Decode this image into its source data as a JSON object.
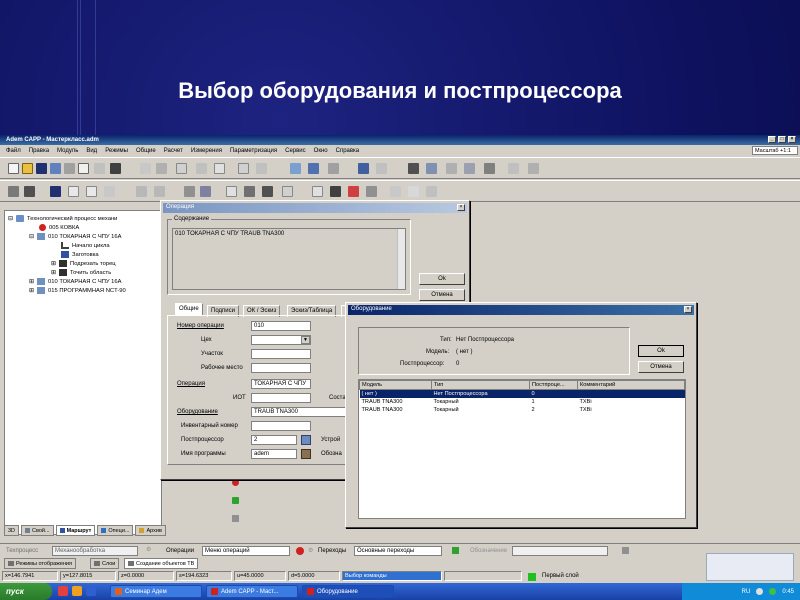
{
  "slide": {
    "title": "Выбор оборудования и постпроцессора"
  },
  "app": {
    "title": "Adem CAPP - Мастеркласс.adm",
    "window_controls": [
      "_",
      "□",
      "×"
    ],
    "menu": [
      "Файл",
      "Правка",
      "Модуль",
      "Вид",
      "Режимы",
      "Общие",
      "Расчет",
      "Измерения",
      "Параметризация",
      "Сервис",
      "Окно",
      "Справка"
    ],
    "zoom": "Масштаб +1:1"
  },
  "tree": {
    "items": [
      {
        "label": "Технологический процесс механи",
        "icon": "process-icon",
        "color": "#6a8fc8"
      },
      {
        "label": "005  КОВКА",
        "icon": "operation-red-icon",
        "color": "#d02020"
      },
      {
        "label": "010  ТОКАРНАЯ С ЧПУ 16А",
        "icon": "operation-icon",
        "color": "#7090c0"
      },
      {
        "label": "Начало цикла",
        "icon": "start-cycle-icon",
        "color": "#404040"
      },
      {
        "label": "Заготовка",
        "icon": "blank-icon",
        "color": "#3050a0"
      },
      {
        "label": "Подрезать торец",
        "icon": "face-icon",
        "color": "#303030"
      },
      {
        "label": "Точить область",
        "icon": "turn-icon",
        "color": "#303030"
      },
      {
        "label": "010  ТОКАРНАЯ С ЧПУ 16А",
        "icon": "operation-icon",
        "color": "#7090c0"
      },
      {
        "label": "015  ПРОГРАММНАЯ NCT-90",
        "icon": "operation-icon",
        "color": "#7090c0"
      }
    ],
    "tabs": [
      "3D",
      "Свой...",
      "Маршрут",
      "Опеци...",
      "Архив"
    ]
  },
  "operation_dialog": {
    "title": "Операция",
    "content_label": "Содержание",
    "content_text": "010  ТОКАРНАЯ С ЧПУ TRAUB TNA300",
    "ok": "Ok",
    "cancel": "Отмена",
    "tabs": [
      "Общие",
      "Подписи",
      "ОК / Эскиз",
      "Эскиз/Таблица",
      "Со"
    ],
    "labels": {
      "op_number": "Номер операции",
      "shop": "Цех",
      "area": "Участок",
      "workplace": "Рабочее место",
      "operation": "Операция",
      "iot": "ИОТ",
      "equipment": "Оборудование",
      "inventory": "Инвентарный номер",
      "postprocessor": "Постпроцессор",
      "program_name": "Имя программы",
      "device": "Устрой",
      "designation": "Обозна",
      "sost": "Соста"
    },
    "values": {
      "op_number": "010",
      "shop": "",
      "area": "",
      "workplace": "",
      "operation": "ТОКАРНАЯ С ЧПУ",
      "iot": "",
      "equipment": "TRAUB TNA300",
      "inventory": "",
      "postprocessor": "2",
      "program_name": "adem"
    }
  },
  "equipment_dialog": {
    "title": "Оборудование",
    "type_label": "Тип:",
    "type_value": "Нет Постпроцессора",
    "model_label": "Модель:",
    "model_value": "( нет )",
    "pp_label": "Постпроцессор:",
    "pp_value": "0",
    "ok": "Ok",
    "cancel": "Отмена",
    "columns": [
      "Модель",
      "Тип",
      "Постпроце...",
      "Комментарий"
    ],
    "rows": [
      [
        "( нет )",
        "Нет Постпроцессора",
        "0",
        ""
      ],
      [
        "TRAUB TNA300",
        "Токарный",
        "1",
        "TXBi"
      ],
      [
        "TRAUB TNA300",
        "Токарный",
        "2",
        "TXBi"
      ]
    ],
    "selected_row": 0
  },
  "bottom_bar": {
    "process_label": "Техпроцесс",
    "process_value": "Механообработка",
    "operations_label": "Операции",
    "operations_value": "Меню операций",
    "transitions_label": "Переходы",
    "transitions_value": "Основные переходы",
    "designation_label": "Обозначение",
    "tabs": [
      "Режимы отображения",
      "Слои",
      "Создание объектов ТВ"
    ]
  },
  "status": {
    "x": "x=146.7941",
    "y": "y=127.8015",
    "z": "z=0.0000",
    "s": "s=194.6323",
    "u": "u=45.0000",
    "d": "d=5.0000",
    "command": "Выбор команды",
    "layer": "Первый слой"
  },
  "taskbar": {
    "start": "пуск",
    "tasks": [
      "Семинар Адем",
      "Adem CAPP - Маст...",
      "Оборудование"
    ],
    "lang": "RU",
    "time": "0:45"
  },
  "colors": {
    "title_active": "#0a246a",
    "title_inactive": "#7a96c2",
    "selection": "#0a246a",
    "slide_bg": "#0e125f"
  }
}
